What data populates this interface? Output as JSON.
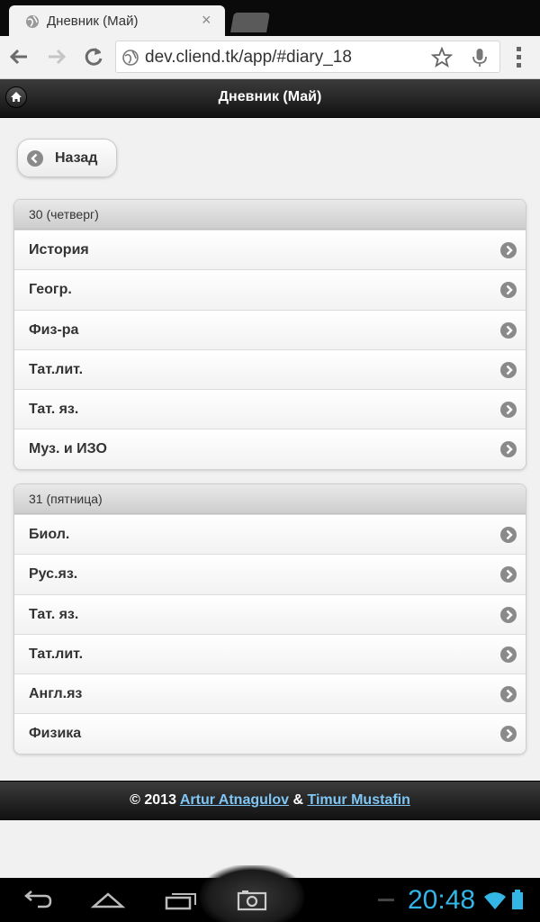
{
  "browser": {
    "tab_title": "Дневник (Май)",
    "tab_close": "×",
    "url": "dev.cliend.tk/app/#diary_18"
  },
  "header": {
    "title": "Дневник (Май)"
  },
  "back_button": {
    "label": "Назад"
  },
  "days": [
    {
      "heading": "30 (четверг)",
      "subjects": [
        "История",
        "Геогр.",
        "Физ-ра",
        "Тат.лит.",
        "Тат. яз.",
        "Муз. и ИЗО"
      ]
    },
    {
      "heading": "31 (пятница)",
      "subjects": [
        "Биол.",
        "Рус.яз.",
        "Тат. яз.",
        "Тат.лит.",
        "Англ.яз",
        "Физика"
      ]
    }
  ],
  "footer": {
    "prefix": "© 2013",
    "author1": "Artur Atnagulov",
    "amp": "&",
    "author2": "Timur Mustafin"
  },
  "status": {
    "time": "20:48"
  },
  "colors": {
    "accent_blue": "#33b5e5",
    "link": "#7fc6f5",
    "header_dark": "#1e1e1e"
  }
}
